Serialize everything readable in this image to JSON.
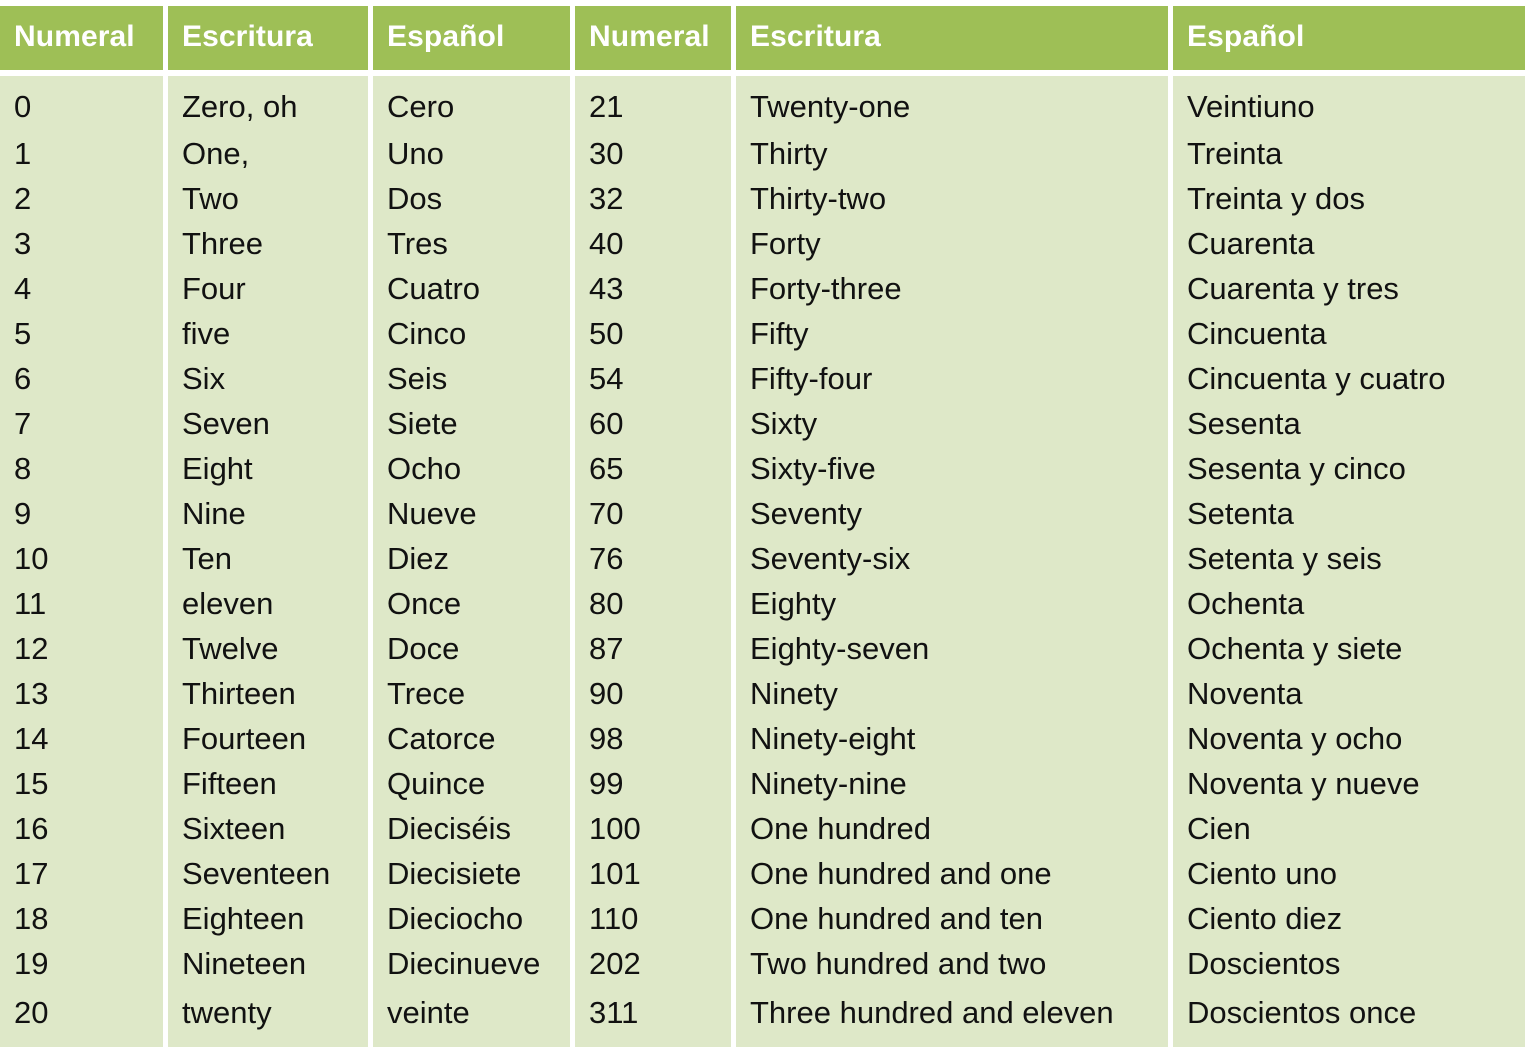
{
  "table": {
    "headers": [
      "Numeral",
      "Escritura",
      "Español",
      "Numeral",
      "Escritura",
      "Español"
    ],
    "colors": {
      "header_background": "#9EBF56",
      "header_text": "#FFFFFF",
      "cell_background": "#DEE8C8",
      "cell_text": "#111111",
      "page_background": "#FFFFFF"
    },
    "rows": [
      {
        "numeral_left": "0",
        "escritura_left": "Zero, oh",
        "espanol_left": "Cero",
        "numeral_right": "21",
        "escritura_right": "Twenty-one",
        "espanol_right": "Veintiuno"
      },
      {
        "numeral_left": "1",
        "escritura_left": "One,",
        "espanol_left": "Uno",
        "numeral_right": "30",
        "escritura_right": "Thirty",
        "espanol_right": "Treinta"
      },
      {
        "numeral_left": "2",
        "escritura_left": "Two",
        "espanol_left": "Dos",
        "numeral_right": "32",
        "escritura_right": "Thirty-two",
        "espanol_right": "Treinta y dos"
      },
      {
        "numeral_left": "3",
        "escritura_left": "Three",
        "espanol_left": "Tres",
        "numeral_right": "40",
        "escritura_right": "Forty",
        "espanol_right": "Cuarenta"
      },
      {
        "numeral_left": "4",
        "escritura_left": "Four",
        "espanol_left": "Cuatro",
        "numeral_right": "43",
        "escritura_right": "Forty-three",
        "espanol_right": "Cuarenta y tres"
      },
      {
        "numeral_left": "5",
        "escritura_left": "five",
        "espanol_left": "Cinco",
        "numeral_right": "50",
        "escritura_right": "Fifty",
        "espanol_right": "Cincuenta"
      },
      {
        "numeral_left": "6",
        "escritura_left": "Six",
        "espanol_left": "Seis",
        "numeral_right": "54",
        "escritura_right": "Fifty-four",
        "espanol_right": "Cincuenta y cuatro"
      },
      {
        "numeral_left": "7",
        "escritura_left": "Seven",
        "espanol_left": "Siete",
        "numeral_right": "60",
        "escritura_right": "Sixty",
        "espanol_right": "Sesenta"
      },
      {
        "numeral_left": "8",
        "escritura_left": "Eight",
        "espanol_left": "Ocho",
        "numeral_right": "65",
        "escritura_right": "Sixty-five",
        "espanol_right": "Sesenta y cinco"
      },
      {
        "numeral_left": "9",
        "escritura_left": "Nine",
        "espanol_left": "Nueve",
        "numeral_right": "70",
        "escritura_right": "Seventy",
        "espanol_right": "Setenta"
      },
      {
        "numeral_left": "10",
        "escritura_left": "Ten",
        "espanol_left": "Diez",
        "numeral_right": "76",
        "escritura_right": "Seventy-six",
        "espanol_right": "Setenta y seis"
      },
      {
        "numeral_left": "11",
        "escritura_left": "eleven",
        "espanol_left": "Once",
        "numeral_right": "80",
        "escritura_right": "Eighty",
        "espanol_right": "Ochenta"
      },
      {
        "numeral_left": "12",
        "escritura_left": "Twelve",
        "espanol_left": "Doce",
        "numeral_right": "87",
        "escritura_right": "Eighty-seven",
        "espanol_right": "Ochenta y siete"
      },
      {
        "numeral_left": "13",
        "escritura_left": "Thirteen",
        "espanol_left": "Trece",
        "numeral_right": "90",
        "escritura_right": "Ninety",
        "espanol_right": "Noventa"
      },
      {
        "numeral_left": "14",
        "escritura_left": "Fourteen",
        "espanol_left": "Catorce",
        "numeral_right": "98",
        "escritura_right": "Ninety-eight",
        "espanol_right": "Noventa y ocho"
      },
      {
        "numeral_left": "15",
        "escritura_left": "Fifteen",
        "espanol_left": "Quince",
        "numeral_right": "99",
        "escritura_right": "Ninety-nine",
        "espanol_right": "Noventa y nueve"
      },
      {
        "numeral_left": "16",
        "escritura_left": "Sixteen",
        "espanol_left": "Dieciséis",
        "numeral_right": "100",
        "escritura_right": "One hundred",
        "espanol_right": "Cien"
      },
      {
        "numeral_left": "17",
        "escritura_left": "Seventeen",
        "espanol_left": "Diecisiete",
        "numeral_right": "101",
        "escritura_right": "One hundred and one",
        "espanol_right": "Ciento uno"
      },
      {
        "numeral_left": "18",
        "escritura_left": "Eighteen",
        "espanol_left": "Dieciocho",
        "numeral_right": "110",
        "escritura_right": "One hundred and ten",
        "espanol_right": "Ciento diez"
      },
      {
        "numeral_left": "19",
        "escritura_left": "Nineteen",
        "espanol_left": "Diecinueve",
        "numeral_right": "202",
        "escritura_right": "Two hundred and two",
        "espanol_right": "Doscientos"
      },
      {
        "numeral_left": "20",
        "escritura_left": "twenty",
        "espanol_left": "veinte",
        "numeral_right": "311",
        "escritura_right": "Three hundred and eleven",
        "espanol_right": "Doscientos once"
      }
    ]
  }
}
